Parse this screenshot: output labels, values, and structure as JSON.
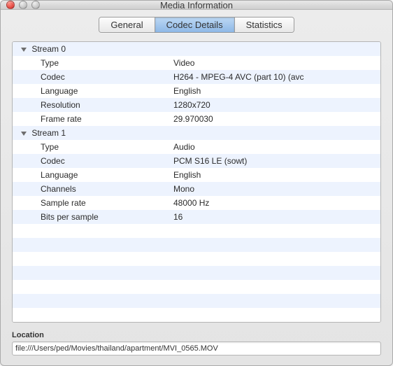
{
  "window": {
    "title": "Media Information"
  },
  "tabs": {
    "general": "General",
    "codec": "Codec Details",
    "stats": "Statistics"
  },
  "streams": [
    {
      "header": "Stream 0",
      "props": [
        {
          "key": "Type",
          "value": "Video"
        },
        {
          "key": "Codec",
          "value": "H264 - MPEG-4 AVC (part 10) (avc"
        },
        {
          "key": "Language",
          "value": "English"
        },
        {
          "key": "Resolution",
          "value": "1280x720"
        },
        {
          "key": "Frame rate",
          "value": "29.970030"
        }
      ]
    },
    {
      "header": "Stream 1",
      "props": [
        {
          "key": "Type",
          "value": "Audio"
        },
        {
          "key": "Codec",
          "value": "PCM S16 LE (sowt)"
        },
        {
          "key": "Language",
          "value": "English"
        },
        {
          "key": "Channels",
          "value": "Mono"
        },
        {
          "key": "Sample rate",
          "value": "48000 Hz"
        },
        {
          "key": "Bits per sample",
          "value": "16"
        }
      ]
    }
  ],
  "location": {
    "label": "Location",
    "value": "file:///Users/ped/Movies/thailand/apartment/MVI_0565.MOV"
  }
}
